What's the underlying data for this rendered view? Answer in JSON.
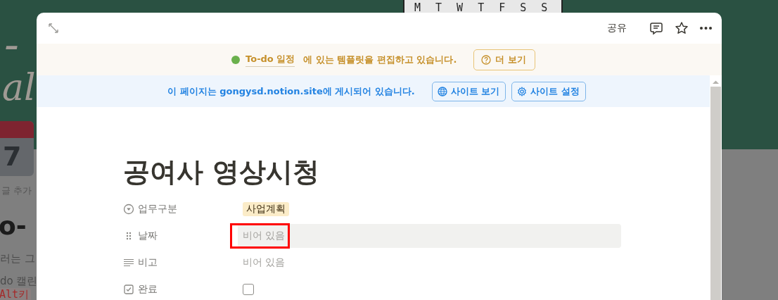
{
  "background_page": {
    "weekday_header": "M T W T F S S",
    "title_fragments": [
      "-",
      "al"
    ],
    "calendar_day": "7",
    "comment_link": "글 추가",
    "heading": "o-",
    "text_lines": [
      "러는 그",
      "do 캘린"
    ],
    "code_snippet": "Alt키"
  },
  "toolbar": {
    "share": "공유"
  },
  "template_banner": {
    "link": "To-do 일정",
    "message": "에 있는 템플릿을 편집하고 있습니다.",
    "button": "더 보기"
  },
  "site_banner": {
    "message": "이 페이지는 gongysd.notion.site에 게시되어 있습니다.",
    "buttons": [
      {
        "kind": "view",
        "label": "사이트 보기"
      },
      {
        "kind": "settings",
        "label": "사이트 설정"
      }
    ]
  },
  "page": {
    "title": "공여사 영상시청",
    "properties": [
      {
        "kind": "select",
        "label": "업무구분",
        "value": "사업계획"
      },
      {
        "kind": "date",
        "label": "날짜",
        "placeholder": "비어 있음",
        "highlighted": true
      },
      {
        "kind": "text",
        "label": "비고",
        "placeholder": "비어 있음",
        "highlighted": false
      },
      {
        "kind": "checkbox",
        "label": "완료",
        "checked": false
      }
    ]
  }
}
